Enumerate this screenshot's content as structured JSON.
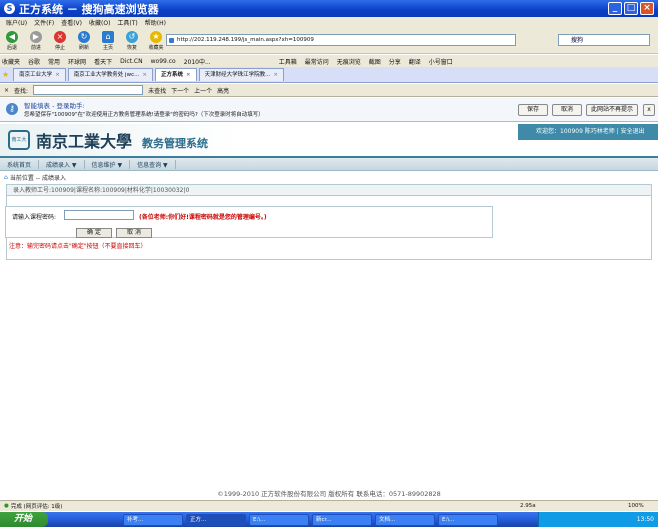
{
  "window": {
    "title": "正方系统 － 搜狗高速浏览器",
    "logo": "S"
  },
  "menu": [
    "账户(U)",
    "文件(F)",
    "查看(V)",
    "收藏(O)",
    "工具(T)",
    "帮助(H)"
  ],
  "toolbar": {
    "back": "后退",
    "forward": "前进",
    "stop": "停止",
    "refresh": "刷新",
    "home": "主页",
    "restore": "恢复",
    "favorites": "收藏夹",
    "address": "http://202.119.248.199/js_main.aspx?xh=100909",
    "search_placeholder": "搜狗"
  },
  "favbar": [
    "收藏夹",
    "谷歌",
    "常用",
    "环球网",
    "看天下",
    "Dict.CN",
    "wo99.co",
    "2010中...",
    "工具箱",
    "最常访问",
    "无痕浏览",
    "截图",
    "分享",
    "翻译",
    "小号窗口"
  ],
  "tabs": [
    {
      "label": "南京工业大学",
      "active": false
    },
    {
      "label": "南京工业大学教务处 jwc...",
      "active": false
    },
    {
      "label": "正方系统",
      "active": true
    },
    {
      "label": "天津财经大学珠江学院教...",
      "active": false
    }
  ],
  "findbar": {
    "label": "查找:",
    "find": "未查找",
    "next": "下一个",
    "prev": "上一个",
    "highlight": "高亮"
  },
  "notify": {
    "title": "智能填表 - 登录助手:",
    "message": "您希望保存\"100909\"在\"欢迎使用正方教务管理系统!请登录\"的密码吗?（下次登录时将自动填写）",
    "save": "保存",
    "cancel": "取消",
    "never": "此网站不再提示",
    "close": "x"
  },
  "system": {
    "seal_text": "南工大",
    "university": "南京工業大學",
    "name": "教务管理系统",
    "welcome": "欢迎您：100909 陈巧林老师 | 安全退出"
  },
  "nav": [
    "系统首页",
    "成绩录入 ▼",
    "信息维护 ▼",
    "信息查询 ▼"
  ],
  "crumb": "当前位置 -- 成绩录入",
  "content": {
    "header": "录入教师工号:100909|课程名称:100909|材料化学|10030032|0",
    "label": "请输入课程密码:",
    "hint": "(各位老师:你们好!课程密码就是您的管理编号。)",
    "confirm": "确 定",
    "cancel": "取 消",
    "note": "注意：输完密码请点击\"确定\"按钮（不要直接回车）"
  },
  "footer": "©1999-2010  正方软件股份有限公司  版权所有  联系电话：0571-89902828",
  "status": {
    "text": "完成 (网页评估: 1级)",
    "zoom": "100%",
    "speed": "2.95a"
  },
  "taskbar": {
    "start": "开始",
    "tasks": [
      {
        "label": "补考...",
        "active": false
      },
      {
        "label": "正方...",
        "active": true
      },
      {
        "label": "E:\\...",
        "active": false
      },
      {
        "label": "新cr...",
        "active": false
      },
      {
        "label": "文档...",
        "active": false
      },
      {
        "label": "E:\\...",
        "active": false
      },
      {
        "label": "罗文...",
        "active": false
      },
      {
        "label": "教学...",
        "active": false
      }
    ],
    "clock": "13:50"
  }
}
